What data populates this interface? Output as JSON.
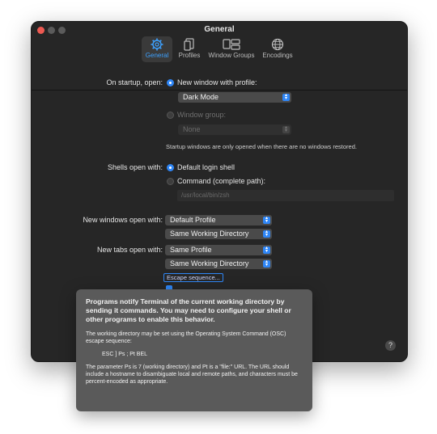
{
  "window": {
    "title": "General"
  },
  "toolbar": {
    "tabs": [
      {
        "label": "General",
        "icon": "gear-icon"
      },
      {
        "label": "Profiles",
        "icon": "profiles-icon"
      },
      {
        "label": "Window Groups",
        "icon": "window-groups-icon"
      },
      {
        "label": "Encodings",
        "icon": "globe-icon"
      }
    ],
    "active_color": "#3da1ff"
  },
  "startup": {
    "label": "On startup, open:",
    "new_window_option": "New window with profile:",
    "profile_selected": "Dark Mode",
    "window_group_option": "Window group:",
    "window_group_selected": "None",
    "note": "Startup windows are only opened when there are no windows restored."
  },
  "shells": {
    "label": "Shells open with:",
    "default_option": "Default login shell",
    "command_option": "Command (complete path):",
    "command_placeholder": "/usr/local/bin/zsh"
  },
  "new_windows": {
    "label": "New windows open with:",
    "profile": "Default Profile",
    "directory": "Same Working Directory"
  },
  "new_tabs": {
    "label": "New tabs open with:",
    "profile": "Same Profile",
    "directory": "Same Working Directory"
  },
  "escape_button": "Escape sequence...",
  "help": "?",
  "tooltip": {
    "heading": "Programs notify Terminal of the current working directory by sending it commands. You may need to configure your shell or other programs to enable this behavior.",
    "para1": "The working directory may be set using the Operating System Command (OSC) escape sequence:",
    "code": "ESC ] Ps ; Pt BEL",
    "para2": "The parameter Ps is 7 (working directory) and Pt is a \"file:\" URL. The URL should include a hostname to disambiguate local and remote paths, and characters must be percent-encoded as appropriate."
  },
  "colors": {
    "accent": "#2f86f6",
    "window_bg": "#262626"
  }
}
